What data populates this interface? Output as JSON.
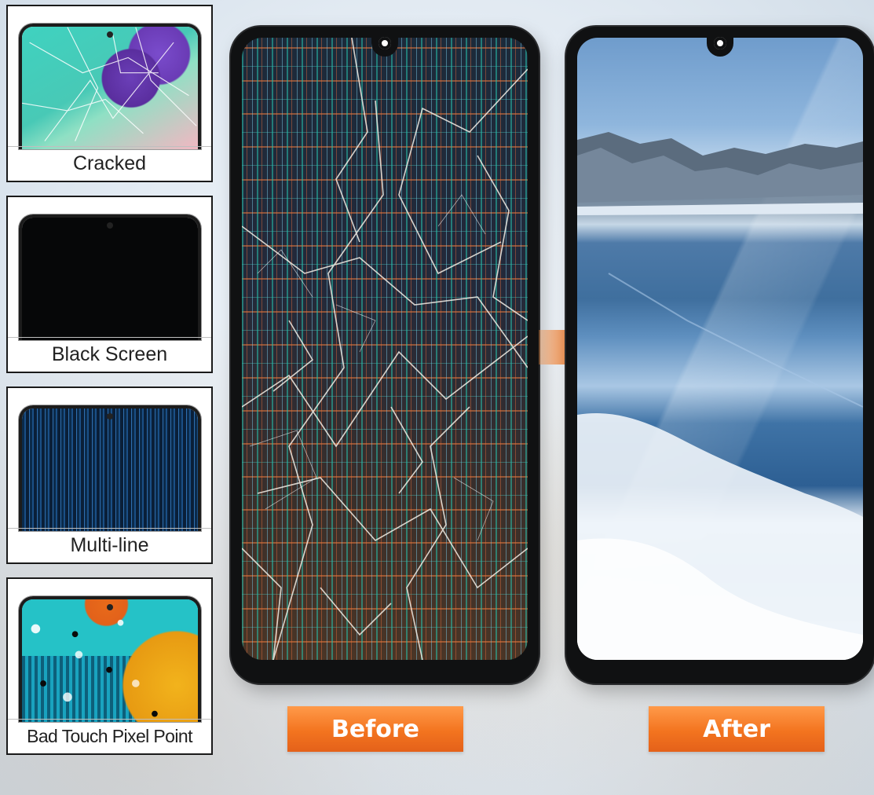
{
  "conditions": [
    {
      "label": "Cracked"
    },
    {
      "label": "Black Screen"
    },
    {
      "label": "Multi-line"
    },
    {
      "label": "Bad Touch Pixel Point"
    }
  ],
  "comparison": {
    "before_label": "Before",
    "after_label": "After"
  },
  "colors": {
    "accent_orange": "#f3741f",
    "frame": "#101112"
  }
}
